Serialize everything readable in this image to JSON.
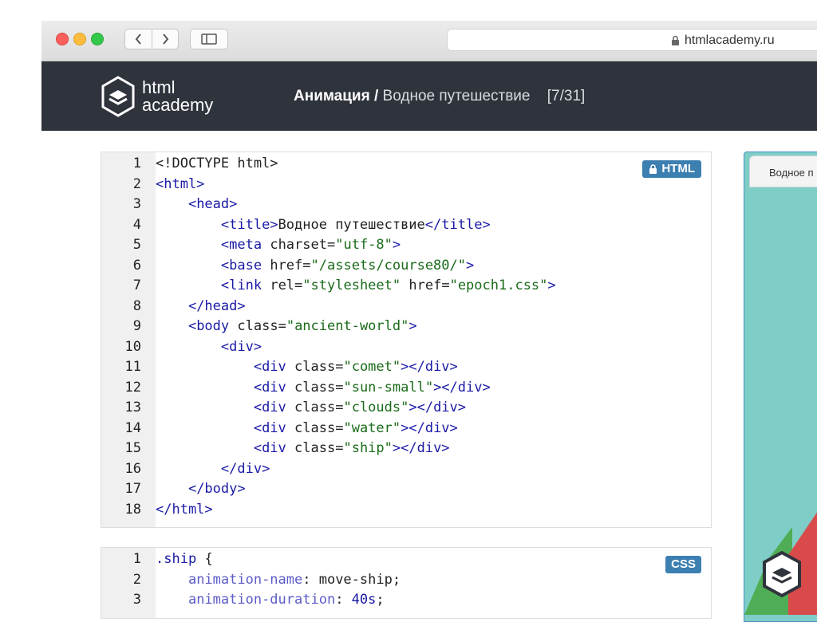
{
  "browser": {
    "url": "htmlacademy.ru"
  },
  "header": {
    "logo_line1": "html",
    "logo_line2": "academy",
    "section": "Анимация",
    "separator": "/",
    "lesson": "Водное путешествие",
    "progress": "[7/31]"
  },
  "html_editor": {
    "badge": "HTML",
    "line_numbers": [
      "1",
      "2",
      "3",
      "4",
      "5",
      "6",
      "7",
      "8",
      "9",
      "10",
      "11",
      "12",
      "13",
      "14",
      "15",
      "16",
      "17",
      "18"
    ]
  },
  "css_editor": {
    "badge": "CSS",
    "line_numbers": [
      "1",
      "2",
      "3"
    ]
  },
  "preview": {
    "tab_title": "Водное п"
  },
  "colors": {
    "header_bg": "#2f333c",
    "badge_blue": "#3c7fb1",
    "preview_bg": "#7ecdc7"
  }
}
